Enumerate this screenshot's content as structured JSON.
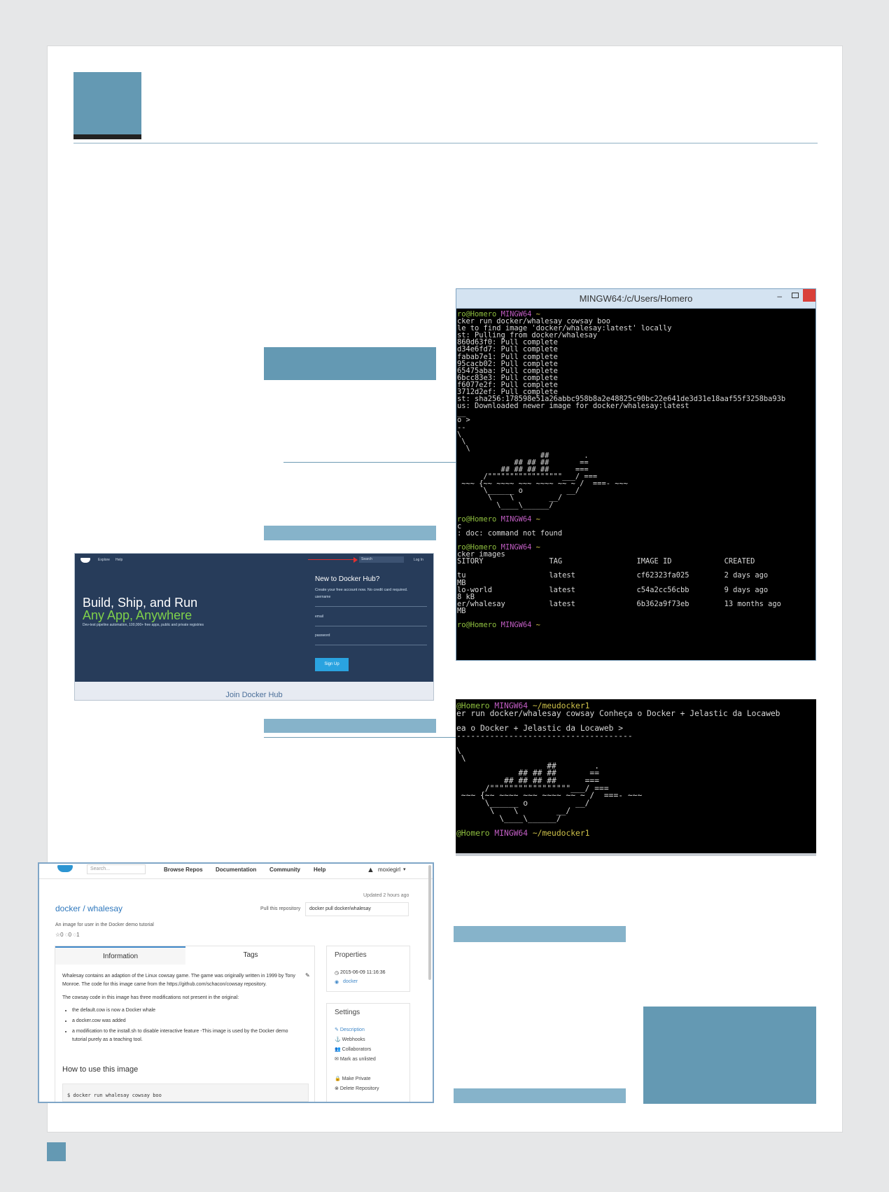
{
  "terminal_1": {
    "title": "MINGW64:/c/Users/Homero",
    "min_glyph": "–",
    "lines": [
      "ro@Homero MINGW64 ~",
      "cker run docker/whalesay cowsay boo",
      "le to find image 'docker/whalesay:latest' locally",
      "st: Pulling from docker/whalesay",
      "860d63f0: Pull complete",
      "d34e6fd7: Pull complete",
      "fabab7e1: Pull complete",
      "95cacb02: Pull complete",
      "65475aba: Pull complete",
      "6bcc83e3: Pull complete",
      "f6077e2f: Pull complete",
      "3712d2ef: Pull complete",
      "st: sha256:178598e51a26abbc958b8a2e48825c90bc22e641de3d31e18aaf55f3258ba93b",
      "us: Downloaded newer image for docker/whalesay:latest",
      "__",
      "o >",
      "--",
      "\\",
      " \\",
      "  \\",
      "                   ##        .",
      "             ## ## ##       ==",
      "          ## ## ## ##      ===",
      "      /\"\"\"\"\"\"\"\"\"\"\"\"\"\"\"\"\"___/ ===",
      " ~~~ {~~ ~~~~ ~~~ ~~~~ ~~ ~ /  ===- ~~~",
      "      \\______ o          __/",
      "       \\    \\        __/",
      "         \\____\\______/",
      "",
      "ro@Homero MINGW64 ~",
      "c",
      ": doc: command not found",
      "",
      "ro@Homero MINGW64 ~",
      "cker images",
      "SITORY               TAG                 IMAGE ID            CREATED",
      "",
      "tu                   latest              cf62323fa025        2 days ago",
      "MB",
      "lo-world             latest              c54a2cc56cbb        9 days ago",
      "8 kB",
      "er/whalesay          latest              6b362a9f73eb        13 months ago",
      "MB",
      "",
      "ro@Homero MINGW64 ~"
    ]
  },
  "terminal_2": {
    "lines": [
      "@Homero MINGW64 ~/meudocker1",
      "er run docker/whalesay cowsay Conheça o Docker + Jelastic da Locaweb",
      "",
      "ea o Docker + Jelastic da Locaweb >",
      "-------------------------------------",
      "",
      "\\",
      " \\",
      "                   ##        .",
      "             ## ## ##       ==",
      "          ## ## ## ##      ===",
      "      /\"\"\"\"\"\"\"\"\"\"\"\"\"\"\"\"\"___/ ===",
      " ~~~ {~~ ~~~~ ~~~ ~~~~ ~~ ~ /  ===- ~~~",
      "      \\______ o          __/",
      "       \\    \\        __/",
      "         \\____\\______/",
      "",
      "@Homero MINGW64 ~/meudocker1"
    ]
  },
  "docker_hub": {
    "nav_explore": "Explore",
    "nav_help": "Help",
    "search": "Search",
    "login": "Log In",
    "headline_1": "Build, Ship, and Run",
    "headline_2": "Any App, Anywhere",
    "tagline": "Dev-test pipeline automation, 100,000+ free apps, public and private registries",
    "new_title": "New to Docker Hub?",
    "new_sub": "Create your free account now. No credit card required.",
    "field_username": "username",
    "field_email": "email",
    "field_password": "password",
    "signup": "Sign Up",
    "caption": "Join Docker Hub"
  },
  "repo_page": {
    "search_placeholder": "Search...",
    "nav": [
      "Browse Repos",
      "Documentation",
      "Community",
      "Help"
    ],
    "user": "moxiegirl",
    "updated": "Updated 2 hours ago",
    "repo_name": "docker / whalesay",
    "pull_label": "Pull this repository",
    "pull_cmd": "docker pull docker/whalesay",
    "description": "An image for user in the Docker demo tutorial",
    "stats": [
      "0",
      "0",
      "1"
    ],
    "tab_info": "Information",
    "tab_tags": "Tags",
    "para_1": "Whalesay contains an adaption of the Linux cowsay game. The game was originally written in 1999 by Tony Monroe. The code for this image came from the https://github.com/schacon/cowsay repository.",
    "para_2": "The cowsay code in this image has three modifications not present in the original:",
    "bullets": [
      "the default.cow is now a Docker whale",
      "a docker.cow was added",
      "a modification to the install.sh to disable interactive feature -This image is used by the Docker demo tutorial purely as a teaching tool."
    ],
    "how_to": "How to use this image",
    "code": "$ docker run whalesay cowsay boo",
    "properties_title": "Properties",
    "prop_date": "2015-06-09 11:16:36",
    "prop_owner": "docker",
    "settings_title": "Settings",
    "settings": [
      "Description",
      "Webhooks",
      "Collaborators",
      "Mark as unlisted"
    ],
    "settings_2": [
      "Make Private",
      "Delete Repository"
    ]
  },
  "colors": {
    "accent_blue": "#6499b3",
    "light_blue": "#86b3ca",
    "page_bg": "#e6e7e8"
  }
}
